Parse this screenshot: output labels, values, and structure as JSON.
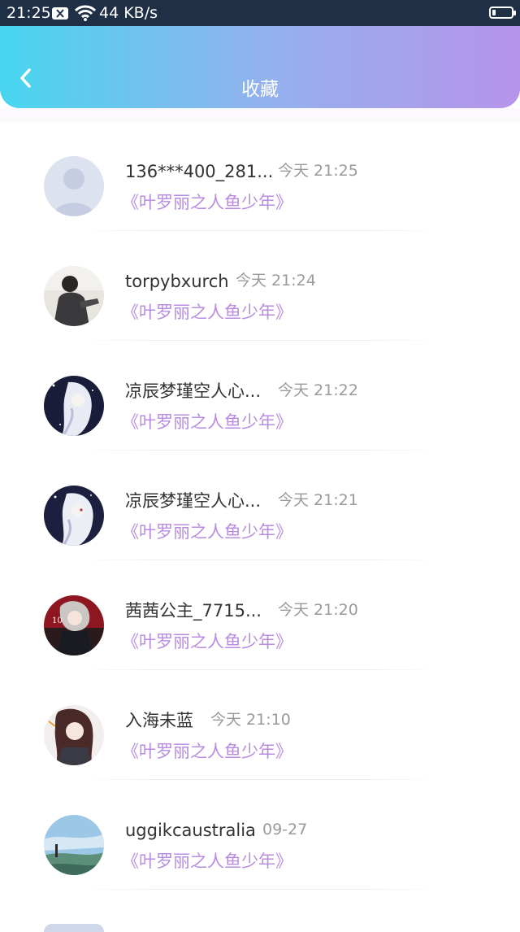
{
  "status_bar": {
    "time": "21:25",
    "network_speed": "44 KB/s"
  },
  "header": {
    "title": "收藏",
    "gradient": [
      "#47d6ef",
      "#92b2ed",
      "#b694ea"
    ]
  },
  "favorites": [
    {
      "name": "136***400_281...",
      "time": "今天 21:25",
      "book": "《叶罗丽之人鱼少年》"
    },
    {
      "name": "torpybxurch",
      "time": "今天 21:24",
      "book": "《叶罗丽之人鱼少年》"
    },
    {
      "name": "凉辰梦瑾空人心...",
      "time": "今天 21:22",
      "book": "《叶罗丽之人鱼少年》"
    },
    {
      "name": "凉辰梦瑾空人心...",
      "time": "今天 21:21",
      "book": "《叶罗丽之人鱼少年》"
    },
    {
      "name": "茜茜公主_7715...",
      "time": "今天 21:20",
      "book": "《叶罗丽之人鱼少年》"
    },
    {
      "name": "入海未蓝",
      "time": "今天 21:10",
      "book": "《叶罗丽之人鱼少年》"
    },
    {
      "name": "uggikcaustralia",
      "time": "09-27",
      "book": "《叶罗丽之人鱼少年》"
    }
  ],
  "colors": {
    "book_title": "#b88ce0",
    "time": "#9a9a9a",
    "name": "#333333"
  }
}
